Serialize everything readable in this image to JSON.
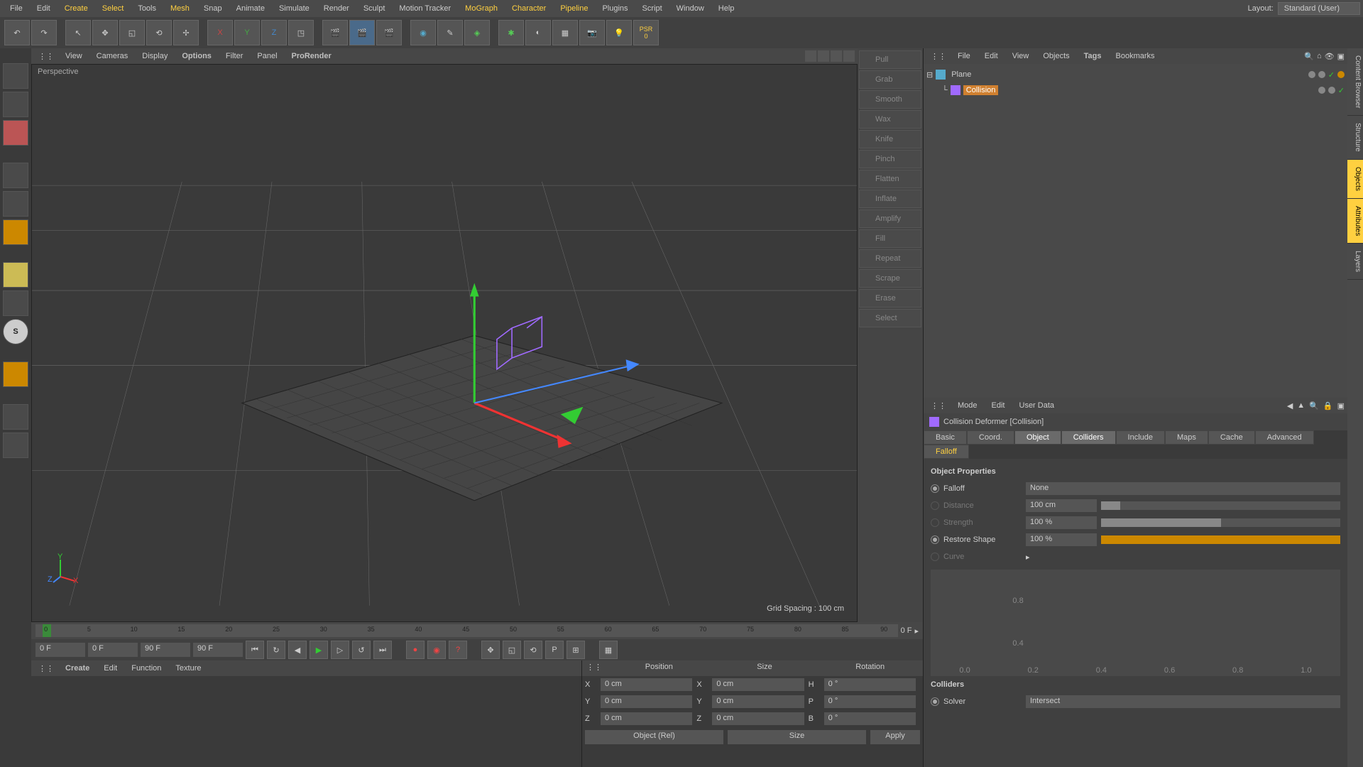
{
  "menubar": [
    "File",
    "Edit",
    "Create",
    "Select",
    "Tools",
    "Mesh",
    "Snap",
    "Animate",
    "Simulate",
    "Render",
    "Sculpt",
    "Motion Tracker",
    "MoGraph",
    "Character",
    "Pipeline",
    "Plugins",
    "Script",
    "Window",
    "Help"
  ],
  "menubar_hl": [
    2,
    3,
    5,
    14
  ],
  "layout": {
    "label": "Layout:",
    "value": "Standard (User)"
  },
  "psr": {
    "label": "PSR",
    "value": "0"
  },
  "viewport_menu": [
    "View",
    "Cameras",
    "Display",
    "Options",
    "Filter",
    "Panel",
    "ProRender"
  ],
  "viewport_menu_hl": [
    3,
    6
  ],
  "viewport": {
    "label": "Perspective",
    "grid": "Grid Spacing : 100 cm",
    "axis_y": "Y",
    "axis_z": "Z",
    "axis_x": "X"
  },
  "sculpt": [
    "Pull",
    "Grab",
    "Smooth",
    "Wax",
    "Knife",
    "Pinch",
    "Flatten",
    "Inflate",
    "Amplify",
    "Fill",
    "Repeat",
    "Scrape",
    "Erase",
    "Select"
  ],
  "timeline": {
    "ticks": [
      "0",
      "5",
      "10",
      "15",
      "20",
      "25",
      "30",
      "35",
      "40",
      "45",
      "50",
      "55",
      "60",
      "65",
      "70",
      "75",
      "80",
      "85",
      "90"
    ],
    "current": "0 F",
    "end": "0 F",
    "start_field": "0 F",
    "endmin": "0 F",
    "endmax": "90 F",
    "endmax2": "90 F"
  },
  "material_menu": [
    "Create",
    "Edit",
    "Function",
    "Texture"
  ],
  "coord": {
    "headers": [
      "Position",
      "Size",
      "Rotation"
    ],
    "rows": [
      {
        "a": "X",
        "av": "0 cm",
        "b": "X",
        "bv": "0 cm",
        "c": "H",
        "cv": "0 °"
      },
      {
        "a": "Y",
        "av": "0 cm",
        "b": "Y",
        "bv": "0 cm",
        "c": "P",
        "cv": "0 °"
      },
      {
        "a": "Z",
        "av": "0 cm",
        "b": "Z",
        "bv": "0 cm",
        "c": "B",
        "cv": "0 °"
      }
    ],
    "mode1": "Object (Rel)",
    "mode2": "Size",
    "apply": "Apply"
  },
  "obj_menu": [
    "File",
    "Edit",
    "View",
    "Objects",
    "Tags",
    "Bookmarks"
  ],
  "obj_tree": {
    "root": "Plane",
    "child": "Collision"
  },
  "attr_menu": [
    "Mode",
    "Edit",
    "User Data"
  ],
  "attr_title": "Collision Deformer [Collision]",
  "attr_tabs": [
    "Basic",
    "Coord.",
    "Object",
    "Colliders",
    "Include",
    "Maps",
    "Cache",
    "Advanced",
    "Falloff"
  ],
  "attr_tabs_active": [
    2,
    3
  ],
  "attr_tabs_hl": [
    8
  ],
  "obj_props": {
    "title": "Object Properties",
    "falloff_label": "Falloff",
    "falloff_value": "None",
    "distance_label": "Distance",
    "distance_value": "100 cm",
    "strength_label": "Strength",
    "strength_value": "100 %",
    "restore_label": "Restore Shape",
    "restore_value": "100 %",
    "curve_label": "Curve",
    "curve_ticks_y": [
      "0.8",
      "0.4"
    ],
    "curve_ticks_x": [
      "0.0",
      "0.2",
      "0.4",
      "0.6",
      "0.8",
      "1.0"
    ]
  },
  "colliders": {
    "title": "Colliders",
    "solver_label": "Solver",
    "solver_value": "Intersect"
  },
  "side_tabs": [
    "Content Browser",
    "Structure",
    "Objects",
    "Attributes",
    "Layers"
  ]
}
